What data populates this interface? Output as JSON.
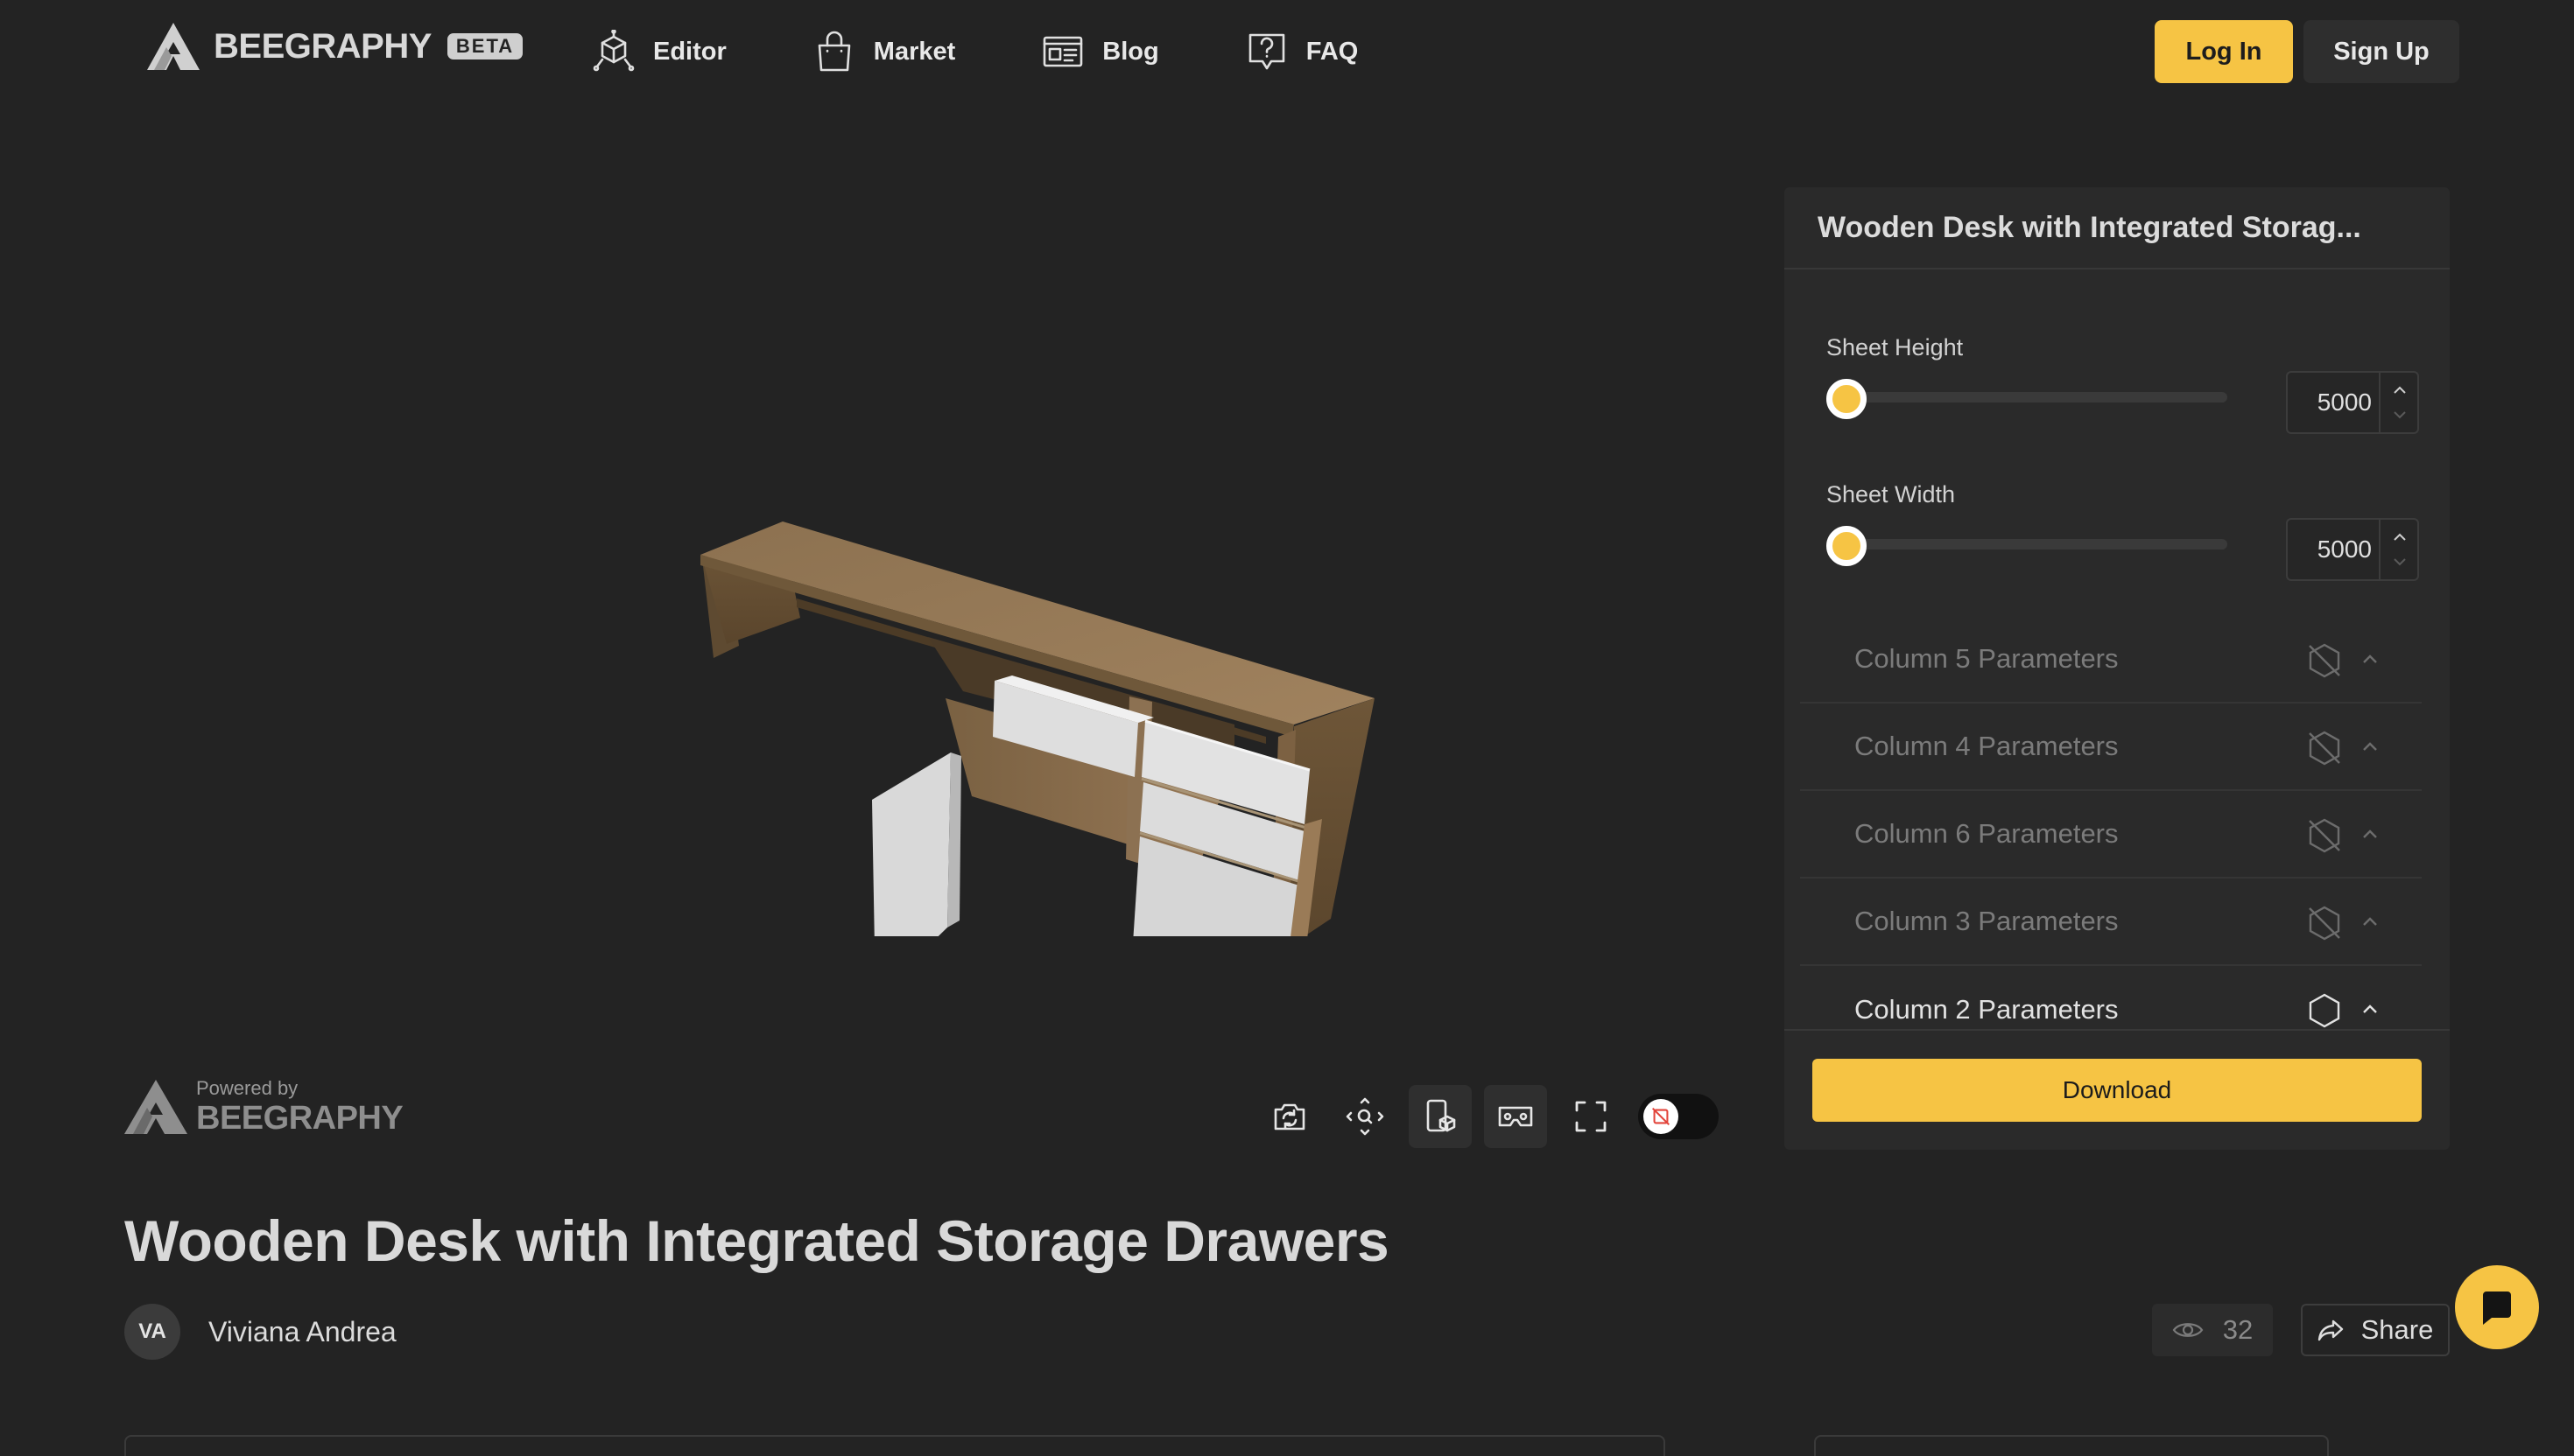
{
  "brand": {
    "name": "BEEGRAPHY",
    "badge": "BETA"
  },
  "nav": [
    {
      "label": "Editor",
      "icon": "editor-icon"
    },
    {
      "label": "Market",
      "icon": "shopping-bag-icon"
    },
    {
      "label": "Blog",
      "icon": "blog-icon"
    },
    {
      "label": "FAQ",
      "icon": "question-icon"
    }
  ],
  "auth": {
    "login": "Log In",
    "signup": "Sign Up"
  },
  "powered": {
    "by": "Powered by",
    "name": "BEEGRAPHY"
  },
  "panel": {
    "title": "Wooden Desk with Integrated Storag...",
    "params": [
      {
        "label": "Sheet Height",
        "value": "5000",
        "fraction": 0.0
      },
      {
        "label": "Sheet Width",
        "value": "5000",
        "fraction": 0.0
      }
    ],
    "columns": [
      {
        "label": "Column 5 Parameters",
        "enabled": false
      },
      {
        "label": "Column 4 Parameters",
        "enabled": false
      },
      {
        "label": "Column 6 Parameters",
        "enabled": false
      },
      {
        "label": "Column 3 Parameters",
        "enabled": false
      },
      {
        "label": "Column 2 Parameters",
        "enabled": true
      }
    ],
    "download": "Download"
  },
  "product": {
    "title": "Wooden Desk with Integrated Storage Drawers",
    "author_initials": "VA",
    "author_name": "Viviana Andrea",
    "views": "32",
    "share": "Share"
  },
  "colors": {
    "accent": "#f6c444",
    "background": "#232323",
    "panel": "#2a2a2a"
  }
}
